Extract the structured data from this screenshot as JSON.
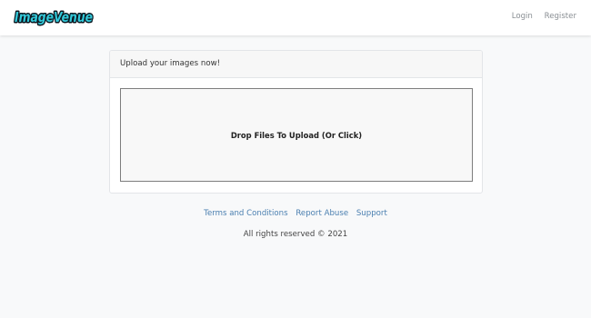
{
  "header": {
    "logo_text": "ImageVenue",
    "nav": {
      "login": "Login",
      "register": "Register"
    }
  },
  "upload_card": {
    "title": "Upload your images now!",
    "dropzone_text": "Drop Files To Upload (Or Click)"
  },
  "footer": {
    "links": {
      "terms": "Terms and Conditions",
      "report": "Report Abuse",
      "support": "Support"
    },
    "copyright": "All rights reserved © 2021"
  },
  "colors": {
    "logo_fill": "#33c9d9",
    "logo_outline": "#0b1720",
    "link": "#4a7fb0",
    "nav_text": "#8a8f94",
    "background": "#f8f9fa"
  }
}
